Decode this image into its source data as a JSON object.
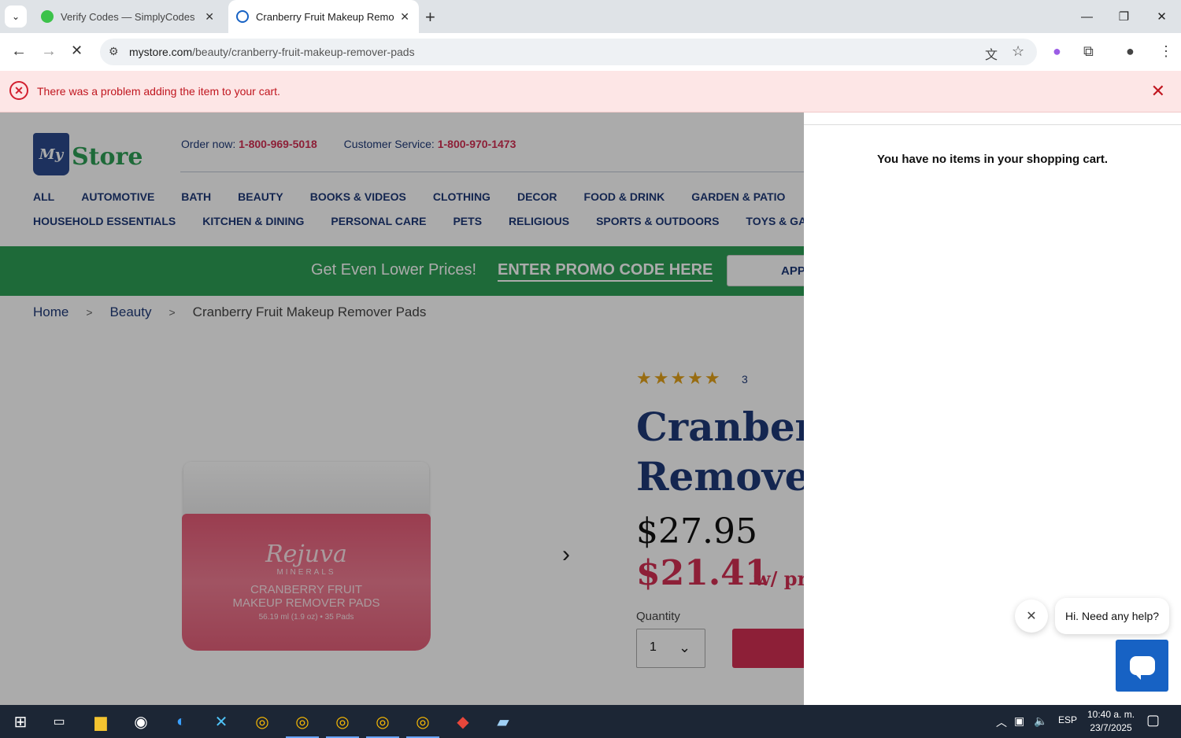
{
  "browser": {
    "tabs": [
      {
        "title": "Verify Codes — SimplyCodes",
        "active": false
      },
      {
        "title": "Cranberry Fruit Makeup Remover Pads",
        "active": true
      }
    ],
    "url_host": "mystore.com",
    "url_path": "/beauty/cranberry-fruit-makeup-remover-pads"
  },
  "error_banner": {
    "message": "There was a problem adding the item to your cart."
  },
  "header": {
    "logo_mark": "My",
    "logo_word": "Store",
    "order_label": "Order now: ",
    "order_phone": "1-800-969-5018",
    "service_label": "Customer Service: ",
    "service_phone": "1-800-970-1473"
  },
  "nav": {
    "row1": [
      "ALL",
      "AUTOMOTIVE",
      "BATH",
      "BEAUTY",
      "BOOKS & VIDEOS",
      "CLOTHING",
      "DECOR",
      "FOOD & DRINK",
      "GARDEN & PATIO"
    ],
    "row2": [
      "HOUSEHOLD ESSENTIALS",
      "KITCHEN & DINING",
      "PERSONAL CARE",
      "PETS",
      "RELIGIOUS",
      "SPORTS & OUTDOORS",
      "TOYS & GAMES"
    ]
  },
  "promo": {
    "lead": "Get Even Lower Prices!",
    "code_link": "ENTER PROMO CODE HERE",
    "apply_label": "APPLY"
  },
  "breadcrumb": [
    "Home",
    "Beauty",
    "Cranberry Fruit Makeup Remover Pads"
  ],
  "product": {
    "stars": "★★★★★",
    "rating": 5,
    "review_count": "3",
    "title_line1": "Cranberry Fruit Makeup",
    "title_line2": "Remover Pads",
    "price_regular": "$27.95",
    "price_promo": "$21.41",
    "price_promo_suffix": "w/ promo",
    "quantity_label": "Quantity",
    "quantity_value": "1",
    "image": {
      "brand": "Rejuva",
      "sub": "MINERALS",
      "name_line1": "CRANBERRY FRUIT",
      "name_line2": "MAKEUP REMOVER PADS",
      "size": "56.19 ml (1.9 oz) • 35 Pads"
    }
  },
  "cart": {
    "empty_message": "You have no items in your shopping cart."
  },
  "chat": {
    "greeting": "Hi. Need any help?"
  },
  "taskbar": {
    "language": "ESP",
    "time": "10:40 a. m.",
    "date": "23/7/2025"
  }
}
